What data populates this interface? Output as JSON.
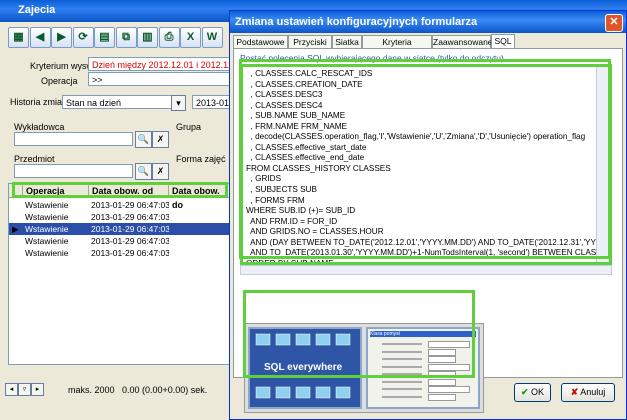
{
  "main": {
    "title": "Zajecia",
    "toolbar_icons": [
      "grid-icon",
      "back-icon",
      "forward-icon",
      "refresh-icon",
      "doc-icon",
      "copy-icon",
      "chart-icon",
      "print-icon",
      "excel-icon",
      "word-icon"
    ],
    "criteria_label": "Kryterium wysw.",
    "criteria_value": "Dzień między  2012.12.01  i  2012.12.31  i",
    "operation_label": "Operacja",
    "operation_value": ">>",
    "history_label": "Historia zmian:",
    "history_value": "Stan na dzień",
    "history_date": "2013-01-30",
    "field_wykladowca": "Wykładowca",
    "field_grupa": "Grupa",
    "field_przedmiot": "Przedmiot",
    "field_forma": "Forma zajęć",
    "grid_headers": [
      "Operacja",
      "Data obow. od",
      "Data obow. do"
    ],
    "grid_rows": [
      {
        "op": "Wstawienie",
        "from": "2013-01-29 06:47:03",
        "to": ""
      },
      {
        "op": "Wstawienie",
        "from": "2013-01-29 06:47:03",
        "to": ""
      },
      {
        "op": "Wstawienie",
        "from": "2013-01-29 06:47:03",
        "to": ""
      },
      {
        "op": "Wstawienie",
        "from": "2013-01-29 06:47:03",
        "to": ""
      },
      {
        "op": "Wstawienie",
        "from": "2013-01-29 06:47:03",
        "to": ""
      }
    ],
    "status_max": "maks. 2000",
    "status_time": "0.00 (0.00+0.00) sek."
  },
  "dialog": {
    "title": "Zmiana ustawień konfiguracyjnych formularza",
    "tabs": [
      "Podstawowe",
      "Przyciski",
      "Siatka",
      "Kryteria filtrowania",
      "Zaawansowane",
      "SQL"
    ],
    "sql_hint": "Postać polecenia SQL wybierającego dane w siatce (tylko do odczytu)",
    "sql_text": "  , CLASSES.CALC_RESCAT_IDS\n  , CLASSES.CREATION_DATE\n  , CLASSES.DESC3\n  , CLASSES.DESC4\n  , SUB.NAME SUB_NAME\n  , FRM.NAME FRM_NAME\n  , decode(CLASSES.operation_flag,'I','Wstawienie','U','Zmiana','D','Usunięcie') operation_flag\n  , CLASSES.effective_start_date\n  , CLASSES.effective_end_date\nFROM CLASSES_HISTORY CLASSES\n  , GRIDS\n  , SUBJECTS SUB\n  , FORMS FRM\nWHERE SUB.ID (+)= SUB_ID\n  AND FRM.ID = FOR_ID\n  AND GRIDS.NO = CLASSES.HOUR\n  AND (DAY BETWEEN TO_DATE('2012.12.01','YYYY.MM.DD') AND TO_DATE('2012.12.31','YYYY.MM.DD') AN\n  AND TO_DATE('2013.01.30','YYYY.MM.DD')+1-NumTodsInterval(1, 'second') BETWEEN CLASSES.EFFECTIVE\nORDER BY SUB.NAME",
    "thumb1_text": "SQL everywhere",
    "thumb2_title": "Klasa pomysł",
    "ok_label": "OK",
    "cancel_label": "Anuluj"
  },
  "colors": {
    "highlight": "#5fcf3c",
    "titlebar": "#0a5fd8",
    "selection": "#2b4fa8"
  }
}
